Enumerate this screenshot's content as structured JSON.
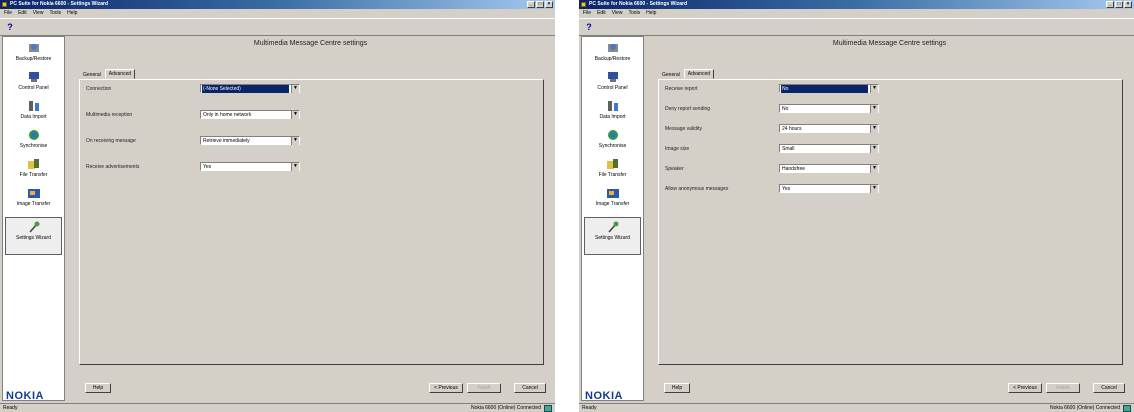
{
  "window_title": "PC Suite for Nokia 6600 - Settings Wizard",
  "title_buttons": [
    "_",
    "□",
    "×"
  ],
  "menu": [
    "File",
    "Edit",
    "View",
    "Tools",
    "Help"
  ],
  "toolbar_help": "?",
  "sidebar": [
    {
      "label": "Backup/Restore",
      "icon": "backup-icon"
    },
    {
      "label": "Control Panel",
      "icon": "control-panel-icon"
    },
    {
      "label": "Data Import",
      "icon": "data-import-icon"
    },
    {
      "label": "Synchronise",
      "icon": "synchronise-icon"
    },
    {
      "label": "File Transfer",
      "icon": "file-transfer-icon"
    },
    {
      "label": "Image Transfer",
      "icon": "image-transfer-icon"
    },
    {
      "label": "Settings Wizard",
      "icon": "settings-wizard-icon"
    }
  ],
  "brand": "NOKIA",
  "wizard_title": "Multimedia Message Centre settings",
  "tabs": [
    "General",
    "Advanced"
  ],
  "general_fields": [
    {
      "label": "Connection",
      "value": "(-None Selected)"
    },
    {
      "label": "Multimedia reception",
      "value": "Only in home network"
    },
    {
      "label": "On receiving message",
      "value": "Retrieve immediately"
    },
    {
      "label": "Receive advertisements",
      "value": "Yes"
    }
  ],
  "advanced_fields": [
    {
      "label": "Receive report",
      "value": "No"
    },
    {
      "label": "Deny report sending",
      "value": "No"
    },
    {
      "label": "Message validity",
      "value": "24 hours"
    },
    {
      "label": "Image size",
      "value": "Small"
    },
    {
      "label": "Speaker",
      "value": "Handsfree"
    },
    {
      "label": "Allow anonymous messages",
      "value": "Yes"
    }
  ],
  "buttons": {
    "help": "Help",
    "previous": "< Previous",
    "finish": "Finish",
    "cancel": "Cancel"
  },
  "status": {
    "left": "Ready",
    "right": "Nokia 6600 (Online)   Connected"
  }
}
